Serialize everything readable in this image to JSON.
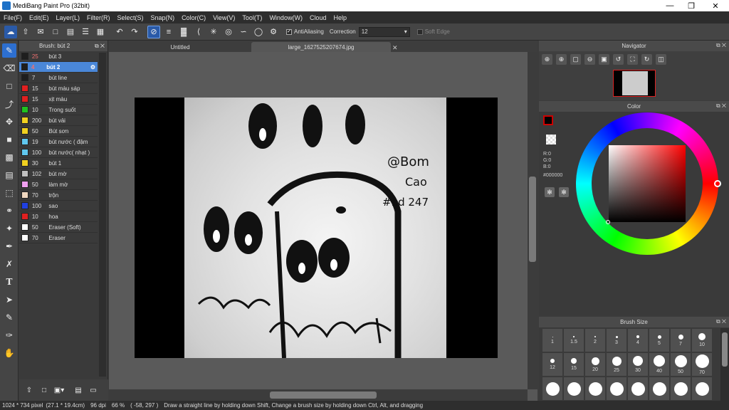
{
  "window": {
    "title": "MediBang Paint Pro (32bit)"
  },
  "menu": [
    "File(F)",
    "Edit(E)",
    "Layer(L)",
    "Filter(R)",
    "Select(S)",
    "Snap(N)",
    "Color(C)",
    "View(V)",
    "Tool(T)",
    "Window(W)",
    "Cloud",
    "Help"
  ],
  "toolbar": {
    "antialiasing_label": "AntiAliasing",
    "antialiasing_checked": true,
    "correction_label": "Correction",
    "correction_value": "12",
    "softedge_label": "Soft Edge",
    "softedge_checked": false
  },
  "brush_panel": {
    "title": "Brush: bút 2",
    "items": [
      {
        "size": "25",
        "name": "bút 3",
        "color": "#1e1e1e",
        "selected": false
      },
      {
        "size": "4",
        "name": "bút 2",
        "color": "#1e1e1e",
        "selected": true
      },
      {
        "size": "7",
        "name": "bút line",
        "color": "#1e1e1e",
        "selected": false
      },
      {
        "size": "15",
        "name": "bút màu sáp",
        "color": "#e02020",
        "selected": false
      },
      {
        "size": "15",
        "name": "xịt màu",
        "color": "#e02020",
        "selected": false
      },
      {
        "size": "10",
        "name": "Trong suốt",
        "color": "#20c020",
        "selected": false
      },
      {
        "size": "200",
        "name": "bút vải",
        "color": "#f0d020",
        "selected": false
      },
      {
        "size": "50",
        "name": "Bút sơn",
        "color": "#f0d020",
        "selected": false
      },
      {
        "size": "19",
        "name": "bút nước ( đậm",
        "color": "#60c8f0",
        "selected": false
      },
      {
        "size": "100",
        "name": "bút nước( nhạt )",
        "color": "#60c8f0",
        "selected": false
      },
      {
        "size": "30",
        "name": "bút 1",
        "color": "#f0d020",
        "selected": false
      },
      {
        "size": "102",
        "name": "bút mờ",
        "color": "#c0c0c0",
        "selected": false
      },
      {
        "size": "50",
        "name": "làm mờ",
        "color": "#f0a0f0",
        "selected": false
      },
      {
        "size": "70",
        "name": "trộn",
        "color": "#f0d8c0",
        "selected": false
      },
      {
        "size": "100",
        "name": "sao",
        "color": "#2040e0",
        "selected": false
      },
      {
        "size": "10",
        "name": "hoa",
        "color": "#e02020",
        "selected": false
      },
      {
        "size": "50",
        "name": "Eraser (Soft)",
        "color": "#ffffff",
        "selected": false
      },
      {
        "size": "70",
        "name": "Eraser",
        "color": "#ffffff",
        "selected": false
      }
    ]
  },
  "tabs": [
    "Untitled",
    "large_1627525207674.jpg"
  ],
  "canvas": {
    "texts": [
      "@Bom",
      "Cao",
      "#hd 247"
    ]
  },
  "navigator": {
    "title": "Navigator"
  },
  "color_panel": {
    "title": "Color",
    "r": "R:0",
    "g": "G:0",
    "b": "B:0",
    "hex": "#000000",
    "current_color": "#000000"
  },
  "brush_size": {
    "title": "Brush Size",
    "sizes": [
      "1",
      "1.5",
      "2",
      "3",
      "4",
      "5",
      "7",
      "10",
      "12",
      "15",
      "20",
      "25",
      "30",
      "40",
      "50",
      "70",
      "",
      "",
      "",
      "",
      "",
      "",
      "",
      ""
    ]
  },
  "status": {
    "dimensions": "1024 * 734 pixel",
    "physical": "(27.1 * 19.4cm)",
    "dpi": "96 dpi",
    "zoom": "66 %",
    "coords": "( -58, 297 )",
    "hint": "Draw a straight line by holding down Shift, Change a brush size by holding down Ctrl, Alt, and dragging"
  }
}
